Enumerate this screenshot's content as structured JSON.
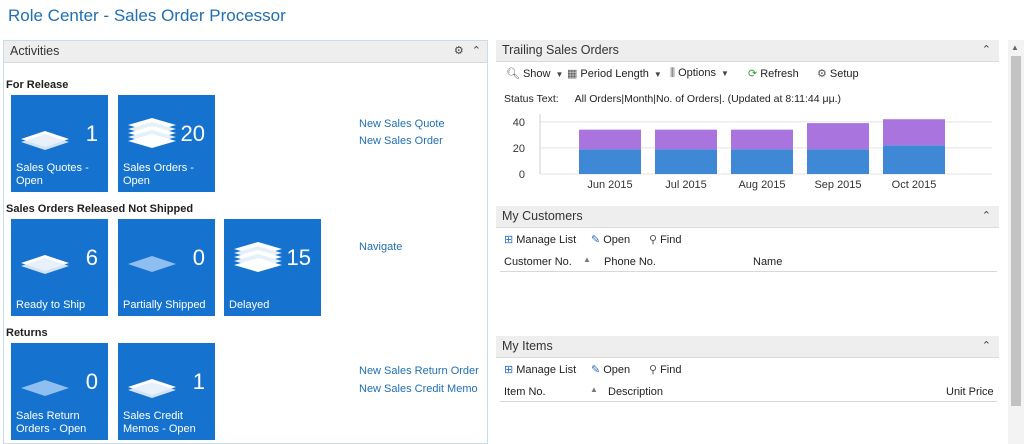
{
  "page_title": "Role Center - Sales Order Processor",
  "activities": {
    "title": "Activities",
    "header_icons": [
      "gear-icon",
      "collapse-icon"
    ],
    "groups": [
      {
        "title": "For Release",
        "tiles": [
          {
            "label": "Sales Quotes - Open",
            "count": "1",
            "icon": "stack-small-icon"
          },
          {
            "label": "Sales Orders - Open",
            "count": "20",
            "icon": "stack-large-icon"
          }
        ],
        "actions": [
          "New Sales Quote",
          "New Sales Order"
        ]
      },
      {
        "title": "Sales Orders Released Not Shipped",
        "tiles": [
          {
            "label": "Ready to Ship",
            "count": "6",
            "icon": "stack-small-icon"
          },
          {
            "label": "Partially Shipped",
            "count": "0",
            "icon": "stack-empty-icon"
          },
          {
            "label": "Delayed",
            "count": "15",
            "icon": "stack-large-icon"
          }
        ],
        "actions": [
          "Navigate"
        ]
      },
      {
        "title": "Returns",
        "tiles": [
          {
            "label": "Sales Return Orders - Open",
            "count": "0",
            "icon": "stack-empty-icon"
          },
          {
            "label": "Sales Credit Memos - Open",
            "count": "1",
            "icon": "stack-small-icon"
          }
        ],
        "actions": [
          "New Sales Return Order",
          "New Sales Credit Memo"
        ]
      }
    ]
  },
  "trailing_orders": {
    "title": "Trailing Sales Orders",
    "toolbar": {
      "show": "Show",
      "period_length": "Period Length",
      "options": "Options",
      "refresh": "Refresh",
      "setup": "Setup"
    },
    "status_label": "Status Text:",
    "status_value": "All Orders|Month|No. of Orders|. (Updated at  8:11:44 μμ.)"
  },
  "chart_data": {
    "type": "bar",
    "stacked": true,
    "categories": [
      "Jun 2015",
      "Jul 2015",
      "Aug 2015",
      "Sep 2015",
      "Oct 2015"
    ],
    "series": [
      {
        "values": [
          19,
          19,
          19,
          19,
          22
        ],
        "color": "#3f88d6"
      },
      {
        "values": [
          15,
          15,
          15,
          20,
          20
        ],
        "color": "#a974dd"
      }
    ],
    "yticks": [
      0,
      20,
      40
    ],
    "ylim": [
      0,
      46
    ],
    "grid": true
  },
  "my_customers": {
    "title": "My Customers",
    "toolbar": {
      "manage_list": "Manage List",
      "open": "Open",
      "find": "Find"
    },
    "columns": [
      "Customer No.",
      "Phone No.",
      "Name"
    ]
  },
  "my_items": {
    "title": "My Items",
    "toolbar": {
      "manage_list": "Manage List",
      "open": "Open",
      "find": "Find"
    },
    "columns": [
      "Item No.",
      "Description",
      "Unit Price"
    ]
  }
}
